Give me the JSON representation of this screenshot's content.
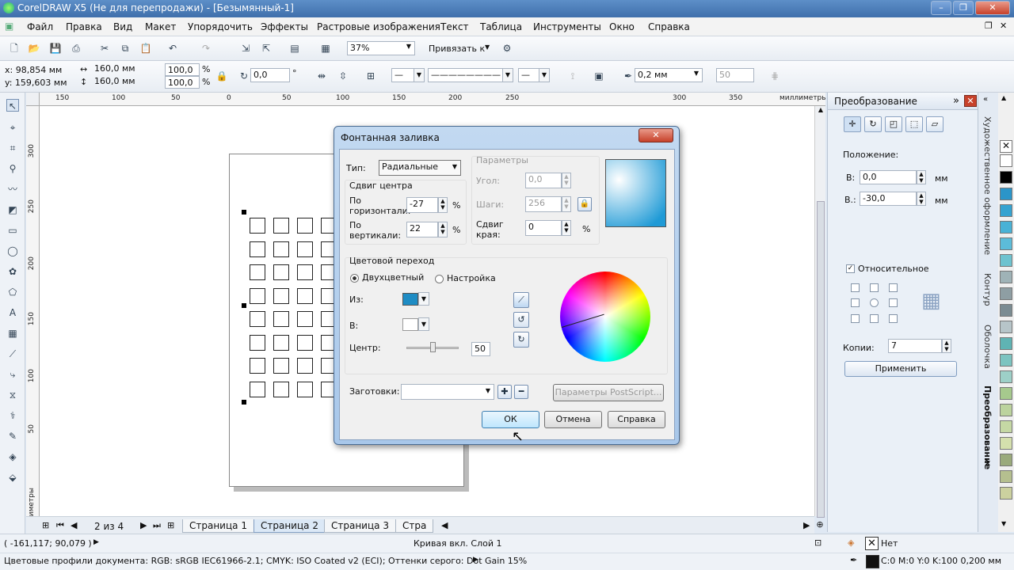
{
  "app": {
    "title": "CorelDRAW X5 (Не для перепродажи) - [Безымянный-1]"
  },
  "menu": [
    "Файл",
    "Правка",
    "Вид",
    "Макет",
    "Упорядочить",
    "Эффекты",
    "Растровые изображения",
    "Текст",
    "Таблица",
    "Инструменты",
    "Окно",
    "Справка"
  ],
  "toolbar": {
    "zoom": "37%",
    "snap": "Привязать к"
  },
  "props": {
    "x": "x: 98,854 мм",
    "y": "y: 159,603 мм",
    "w": "160,0 мм",
    "h": "160,0 мм",
    "sx": "100,0",
    "sy": "100,0",
    "pct": "%",
    "angle": "0,0",
    "deg": "°",
    "outline": "0,2 мм",
    "nudge": "50"
  },
  "ruler": {
    "h_ticks": [
      "150",
      "100",
      "50",
      "0",
      "50",
      "100",
      "150",
      "200",
      "250",
      "300",
      "350"
    ],
    "unit": "миллиметры",
    "v_ticks": [
      "300",
      "250",
      "200",
      "150",
      "100",
      "50"
    ],
    "v_unit": "миллиметры"
  },
  "pages": {
    "counter": "2 из 4",
    "tabs": [
      "Страница 1",
      "Страница 2",
      "Страница 3",
      "Стра"
    ]
  },
  "status": {
    "coords": "( -161,117; 90,079 )",
    "object": "Кривая вкл. Слой 1",
    "profiles": "Цветовые профили документа: RGB: sRGB IEC61966-2.1; CMYK: ISO Coated v2 (ECI); Оттенки серого: Dot Gain 15%",
    "fill": "Нет",
    "outline": "C:0 M:0 Y:0 K:100  0,200 мм"
  },
  "docker": {
    "title": "Преобразование",
    "position_label": "Положение:",
    "h_label": "В:",
    "h_value": "0,0",
    "v_label": "В.:",
    "v_value": "-30,0",
    "unit": "мм",
    "relative": "Относительное",
    "copies_label": "Копии:",
    "copies_value": "7",
    "apply": "Применить"
  },
  "vtabs": [
    "Художественное оформление",
    "Контур",
    "Оболочка",
    "Преобразование"
  ],
  "colors": {
    "palette": [
      "#ffffff",
      "#000000",
      "#2b95c9",
      "#35a3d0",
      "#49b2d6",
      "#5cbcd9",
      "#6ec3cf",
      "#9fb3b7",
      "#8e9ea3",
      "#7b8c92",
      "#b7c5c9",
      "#5fb3b3",
      "#7cc4c0",
      "#9dd0c8",
      "#a6c98d",
      "#bcd39d",
      "#c5d8a4",
      "#d5e0ad",
      "#9aaa7b",
      "#b5bf8f",
      "#ccd19f"
    ],
    "dialog_preview": "#1f9ad6",
    "from_color": "#1e8cc4"
  },
  "dialog": {
    "title": "Фонтанная заливка",
    "type_label": "Тип:",
    "type_value": "Радиальные",
    "center_offset": "Сдвиг центра",
    "horiz_label": "По горизонтали:",
    "horiz_value": "-27",
    "vert_label": "По вертикали:",
    "vert_value": "22",
    "pct": "%",
    "params": "Параметры",
    "angle_label": "Угол:",
    "angle_value": "0,0",
    "steps_label": "Шаги:",
    "steps_value": "256",
    "edge_label": "Сдвиг края:",
    "edge_value": "0",
    "blend": "Цветовой переход",
    "two_color": "Двухцветный",
    "custom": "Настройка",
    "from": "Из:",
    "to": "В:",
    "mid": "Центр:",
    "mid_value": "50",
    "presets": "Заготовки:",
    "postscript": "Параметры PostScript...",
    "ok": "ОК",
    "cancel": "Отмена",
    "help": "Справка"
  }
}
